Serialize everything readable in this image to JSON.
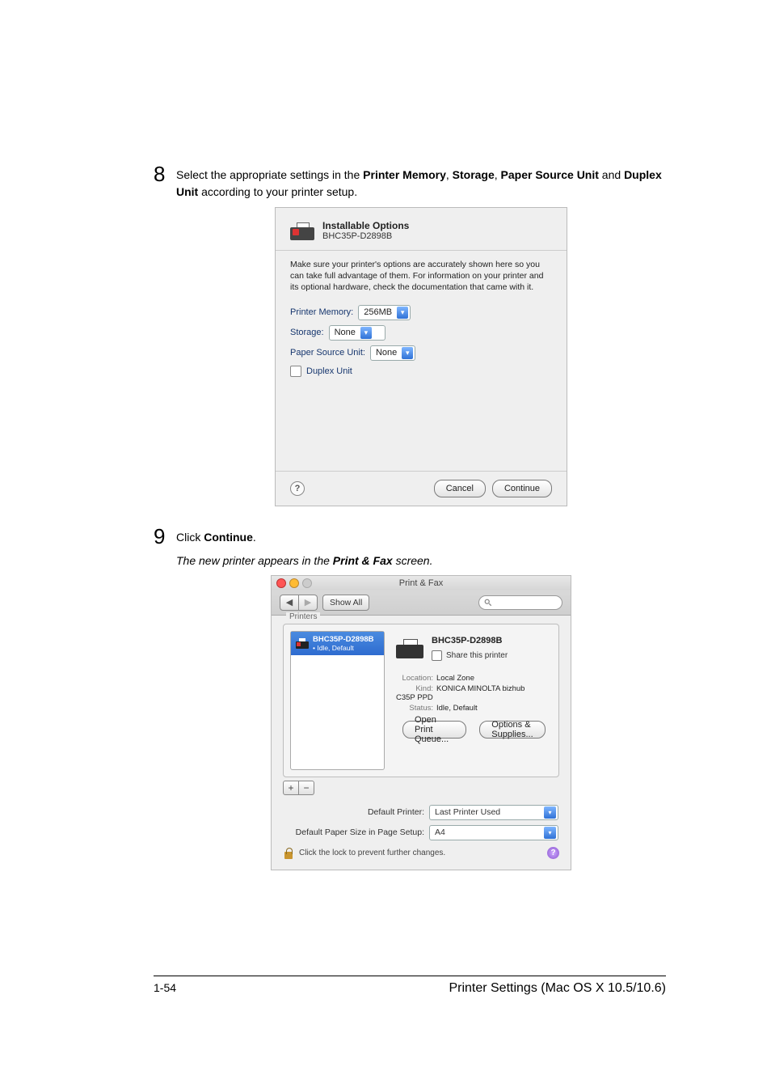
{
  "step8": {
    "num": "8",
    "text_prefix": "Select the appropriate settings in the ",
    "b1": "Printer Memory",
    "sep1": ", ",
    "b2": "Storage",
    "sep2": ", ",
    "b3": "Paper Source Unit",
    "mid": " and ",
    "b4": "Duplex Unit",
    "suffix": " according to your printer setup."
  },
  "dlg1": {
    "title": "Installable Options",
    "printer": "BHC35P-D2898B",
    "msg": "Make sure your printer's options are accurately shown here so you can take full advantage of them. For information on your printer and its optional hardware, check the documentation that came with it.",
    "mem_label": "Printer Memory:",
    "mem_val": "256MB",
    "storage_label": "Storage:",
    "storage_val": "None",
    "psu_label": "Paper Source Unit:",
    "psu_val": "None",
    "duplex": "Duplex Unit",
    "cancel": "Cancel",
    "continue": "Continue"
  },
  "step9": {
    "num": "9",
    "prefix": "Click ",
    "b": "Continue",
    "suffix": "."
  },
  "result_line": {
    "a": "The new printer appears in the ",
    "b": "Print & Fax",
    "c": " screen."
  },
  "dlg2": {
    "wtitle": "Print & Fax",
    "showall": "Show All",
    "printers_label": "Printers",
    "item_name": "BHC35P-D2898B",
    "item_status": "• Idle, Default",
    "right_name": "BHC35P-D2898B",
    "share": "Share this printer",
    "loc_k": "Location:",
    "loc_v": "Local Zone",
    "kind_k": "Kind:",
    "kind_v": "KONICA MINOLTA bizhub C35P PPD",
    "stat_k": "Status:",
    "stat_v": "Idle, Default",
    "open_queue": "Open Print Queue...",
    "opts": "Options & Supplies...",
    "plus": "+",
    "minus": "−",
    "def_printer_lbl": "Default Printer:",
    "def_printer_val": "Last Printer Used",
    "def_paper_lbl": "Default Paper Size in Page Setup:",
    "def_paper_val": "A4",
    "lock_text": "Click the lock to prevent further changes."
  },
  "footer": {
    "page": "1-54",
    "title": "Printer Settings (Mac OS X 10.5/10.6)"
  }
}
